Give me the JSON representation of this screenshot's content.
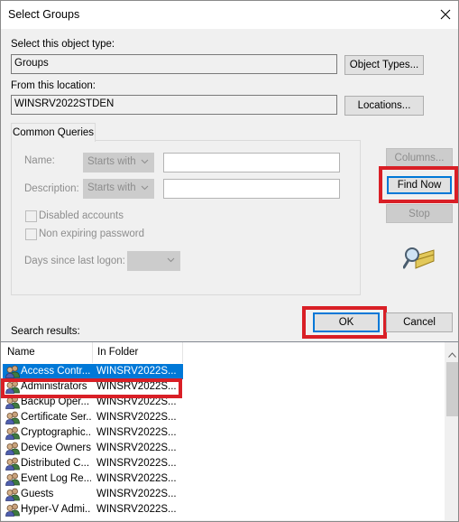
{
  "window": {
    "title": "Select Groups"
  },
  "object_type": {
    "label": "Select this object type:",
    "value": "Groups",
    "button": "Object Types..."
  },
  "location": {
    "label": "From this location:",
    "value": "WINSRV2022STDEN",
    "button": "Locations..."
  },
  "queries": {
    "tab": "Common Queries",
    "name_label": "Name:",
    "name_mode": "Starts with",
    "description_label": "Description:",
    "description_mode": "Starts with",
    "disabled_label": "Disabled accounts",
    "nonexpiring_label": "Non expiring password",
    "days_label": "Days since last logon:"
  },
  "buttons": {
    "columns": "Columns...",
    "find_now": "Find Now",
    "stop": "Stop",
    "ok": "OK",
    "cancel": "Cancel"
  },
  "results": {
    "label": "Search results:",
    "columns": [
      "Name",
      "In Folder"
    ],
    "rows": [
      {
        "name": "Access Contr...",
        "folder": "WINSRV2022S..."
      },
      {
        "name": "Administrators",
        "folder": "WINSRV2022S..."
      },
      {
        "name": "Backup Oper...",
        "folder": "WINSRV2022S..."
      },
      {
        "name": "Certificate Ser...",
        "folder": "WINSRV2022S..."
      },
      {
        "name": "Cryptographic...",
        "folder": "WINSRV2022S..."
      },
      {
        "name": "Device Owners",
        "folder": "WINSRV2022S..."
      },
      {
        "name": "Distributed C...",
        "folder": "WINSRV2022S..."
      },
      {
        "name": "Event Log Re...",
        "folder": "WINSRV2022S..."
      },
      {
        "name": "Guests",
        "folder": "WINSRV2022S..."
      },
      {
        "name": "Hyper-V Admi...",
        "folder": "WINSRV2022S..."
      }
    ]
  },
  "colors": {
    "selection": "#0078d7",
    "highlight": "#d91f26"
  }
}
